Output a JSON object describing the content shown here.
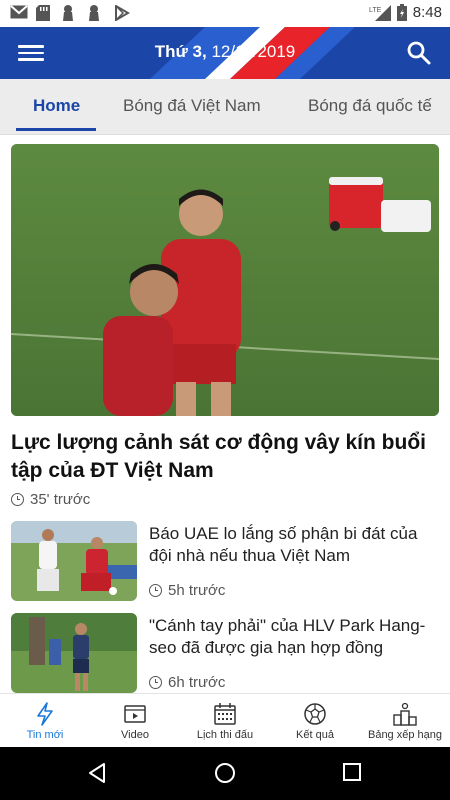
{
  "status_bar": {
    "network": "LTE",
    "time": "8:48"
  },
  "header": {
    "day": "Thứ 3,",
    "date": "12/11/2019",
    "menu_icon": "hamburger-icon",
    "search_icon": "search-icon",
    "colors": {
      "primary": "#1b46a8",
      "accent": "#e8232a"
    }
  },
  "tabs": [
    {
      "label": "Home",
      "active": true
    },
    {
      "label": "Bóng đá Việt Nam",
      "active": false
    },
    {
      "label": "Bóng đá quốc tế",
      "active": false
    }
  ],
  "featured": {
    "title": "Lực lượng cảnh sát cơ động vây kín buổi tập của ĐT Việt Nam",
    "time": "35' trước"
  },
  "articles": [
    {
      "title": " Báo UAE lo lắng số phận bi đát của đội nhà nếu thua Việt Nam",
      "time": "5h trước"
    },
    {
      "title": "\"Cánh tay phải\" của HLV Park Hang-seo đã được gia hạn hợp đồng",
      "time": "6h trước"
    }
  ],
  "bottom_nav": [
    {
      "label": "Tin mới",
      "icon": "lightning-icon",
      "active": true
    },
    {
      "label": "Video",
      "icon": "video-icon",
      "active": false
    },
    {
      "label": "Lịch thi đấu",
      "icon": "calendar-icon",
      "active": false
    },
    {
      "label": "Kết quả",
      "icon": "ball-icon",
      "active": false
    },
    {
      "label": "Bảng xếp hạng",
      "icon": "podium-icon",
      "active": false
    }
  ]
}
